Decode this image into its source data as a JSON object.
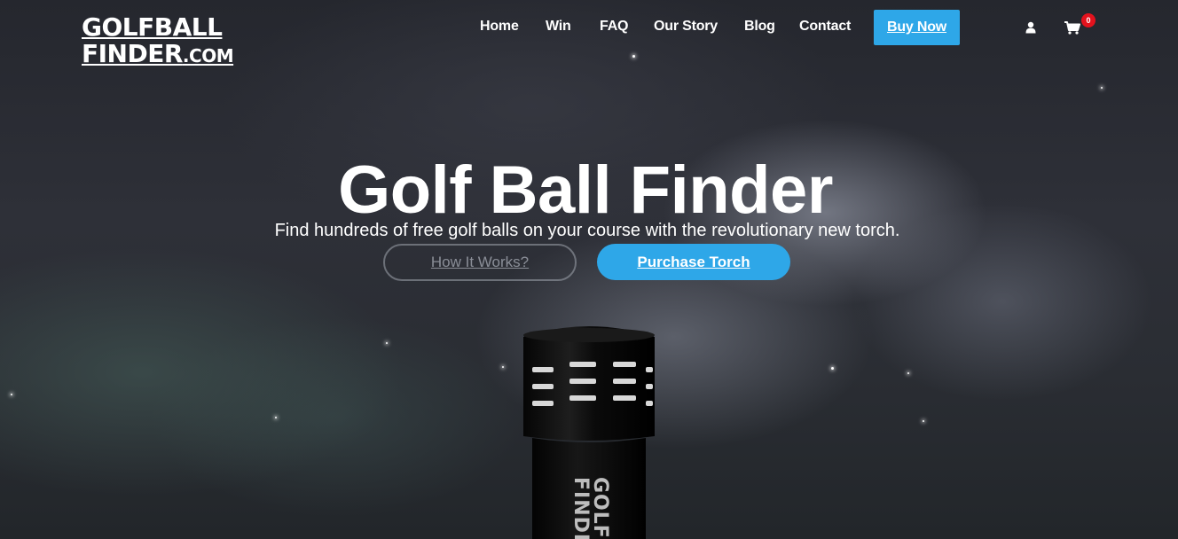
{
  "brand": {
    "logo_line1": "GOLFBALL",
    "logo_line2": "FINDER",
    "logo_suffix": ".COM"
  },
  "nav": {
    "items": [
      "Home",
      "Win",
      "FAQ",
      "Our Story",
      "Blog",
      "Contact"
    ],
    "buy_now": "Buy Now",
    "cart_count": "0",
    "icons": {
      "account": "user-icon",
      "cart": "cart-icon"
    }
  },
  "hero": {
    "title": "Golf Ball Finder",
    "subtitle": "Find hundreds of free golf balls on your course with the revolutionary new torch.",
    "secondary_cta": "How It Works?",
    "primary_cta": "Purchase Torch",
    "product_image": "torch-image",
    "torch_text_line1": "GOLF",
    "torch_text_line2": "FINDER"
  },
  "colors": {
    "accent": "#2ea7e8",
    "badge": "#e3121d",
    "text": "#ffffff"
  }
}
